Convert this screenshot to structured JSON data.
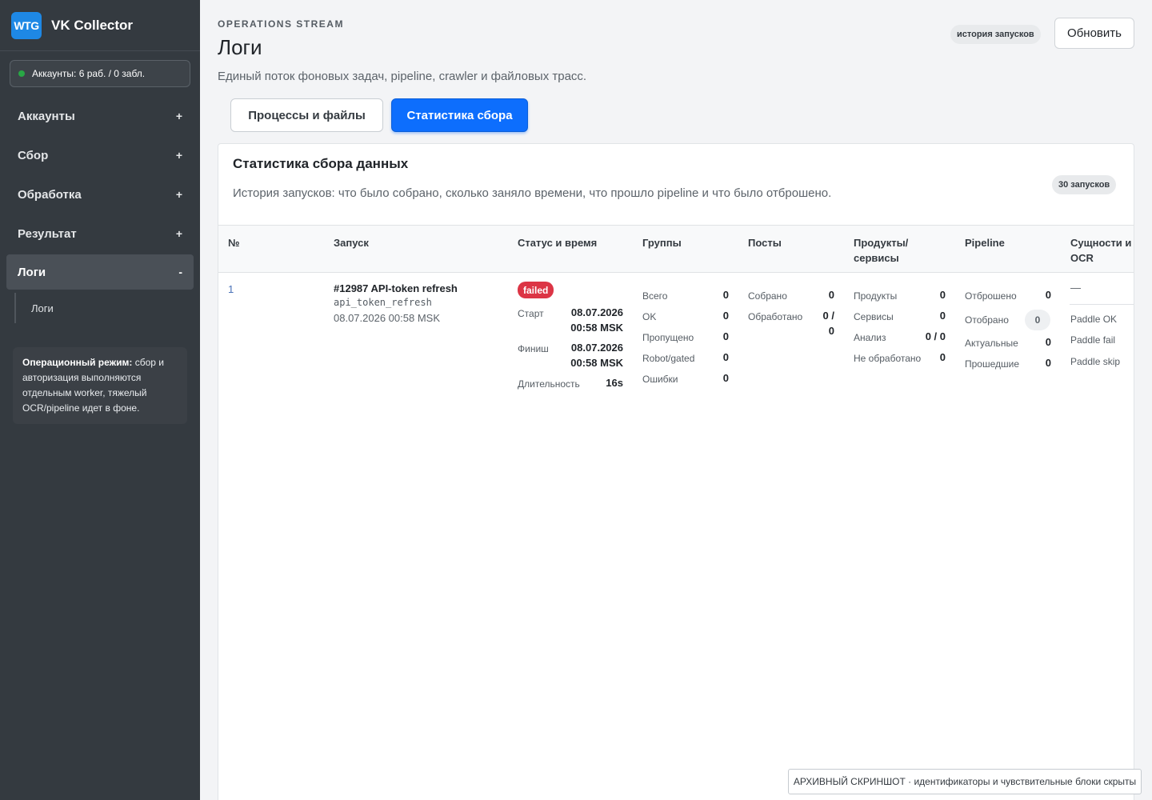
{
  "brand": {
    "logo": "WTG",
    "name": "VK Collector"
  },
  "accounts_status": "Аккаунты: 6 раб. / 0 забл.",
  "sidebar": {
    "items": [
      {
        "label": "Аккаунты",
        "toggle": "+"
      },
      {
        "label": "Сбор",
        "toggle": "+"
      },
      {
        "label": "Обработка",
        "toggle": "+"
      },
      {
        "label": "Результат",
        "toggle": "+"
      },
      {
        "label": "Логи",
        "toggle": "-"
      }
    ],
    "sub_item": "Логи",
    "note_bold": "Операционный режим:",
    "note_text": " сбор и авторизация выполняются отдельным worker, тяжелый OCR/pipeline идет в фоне."
  },
  "header": {
    "eyebrow": "OPERATIONS STREAM",
    "title": "Логи",
    "subtitle": "Единый поток фоновых задач, pipeline, crawler и файловых трасс.",
    "history_badge": "история запусков",
    "refresh_label": "Обновить"
  },
  "tabs": [
    {
      "label": "Процессы и файлы",
      "active": false
    },
    {
      "label": "Статистика сбора",
      "active": true
    }
  ],
  "card": {
    "title": "Статистика сбора данных",
    "description": "История запусков: что было собрано, сколько заняло времени, что прошло pipeline и что было отброшено.",
    "runs_badge": "30 запусков"
  },
  "table": {
    "columns": [
      "№",
      "Запуск",
      "Статус и время",
      "Группы",
      "Посты",
      "Продукты/ сервисы",
      "Pipeline",
      "Сущности и OCR"
    ],
    "row": {
      "num": "1",
      "run_title": "#12987 API-token refresh",
      "run_code": "api_token_refresh",
      "run_time": "08.07.2026 00:58 MSK",
      "status": "failed",
      "start_label": "Старт",
      "start_date": "08.07.2026",
      "start_time": "00:58 MSK",
      "finish_label": "Финиш",
      "finish_date": "08.07.2026",
      "finish_time": "00:58 MSK",
      "duration_label": "Длительность",
      "duration": "16s",
      "groups": {
        "total_label": "Всего",
        "total": "0",
        "ok_label": "OK",
        "ok": "0",
        "skipped_label": "Пропущено",
        "skipped": "0",
        "robot_label": "Robot/gated",
        "robot": "0",
        "errors_label": "Ошибки",
        "errors": "0"
      },
      "posts": {
        "collected_label": "Собрано",
        "collected": "0",
        "processed_label": "Обработано",
        "processed_a": "0 /",
        "processed_b": "0"
      },
      "products": {
        "products_label": "Продукты",
        "products": "0",
        "services_label": "Сервисы",
        "services": "0",
        "analysis_label": "Анализ",
        "analysis": "0 / 0",
        "unprocessed_label": "Не обработано",
        "unprocessed": "0"
      },
      "pipeline": {
        "rejected_label": "Отброшено",
        "rejected": "0",
        "selected_label": "Отобрано",
        "selected": "0",
        "actual_label": "Актуальные",
        "actual": "0",
        "passed_label": "Прошедшие",
        "passed": "0"
      },
      "ocr": {
        "dash": "—",
        "ok_label": "Paddle OK",
        "fail_label": "Paddle fail",
        "skip_label": "Paddle skip"
      }
    }
  },
  "archive_note": "АРХИВНЫЙ СКРИНШОТ · идентификаторы и чувствительные блоки скрыты",
  "colors": {
    "sidebar_bg": "#343a40",
    "accent": "#0d6efd",
    "failed": "#dc3545",
    "online": "#28a745"
  }
}
